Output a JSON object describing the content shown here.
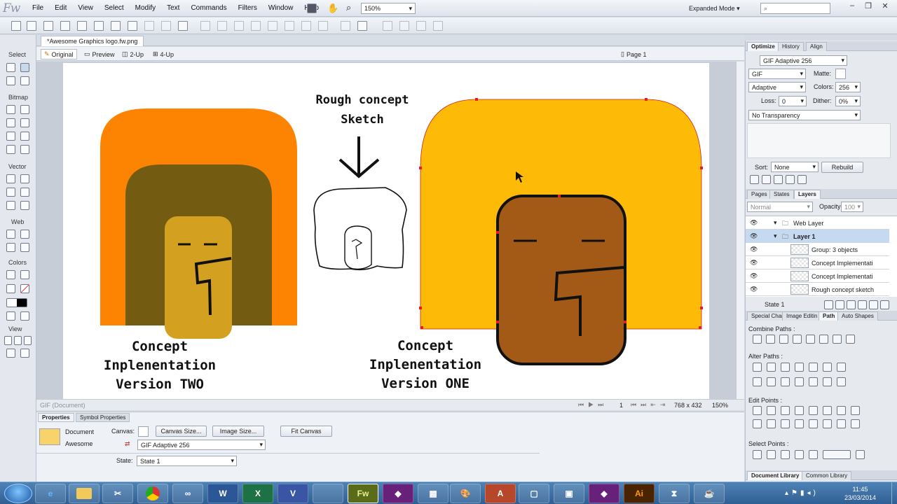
{
  "app": {
    "logo": "Fw",
    "menus": [
      "File",
      "Edit",
      "View",
      "Select",
      "Modify",
      "Text",
      "Commands",
      "Filters",
      "Window",
      "Help"
    ],
    "zoom": "150%",
    "mode": "Expanded Mode",
    "search_placeholder": ""
  },
  "tools": {
    "sections": [
      "Select",
      "Bitmap",
      "Vector",
      "Web",
      "Colors",
      "View"
    ]
  },
  "document": {
    "tab": "*Awesome Graphics logo.fw.png",
    "views": [
      "Original",
      "Preview",
      "2-Up",
      "4-Up"
    ],
    "page": "Page 1"
  },
  "canvas": {
    "rough_title": "Rough concept sketch",
    "caption_two": [
      "Concept",
      "Inplenentation",
      "Version TWO"
    ],
    "caption_one": [
      "Concept",
      "Inplenentation",
      "Version ONE"
    ],
    "colors": {
      "orange": "#fd8403",
      "olive": "#735c11",
      "mustard": "#d4a020",
      "gold": "#fdba07",
      "brown": "#a45a17"
    }
  },
  "status": {
    "left": "GIF (Document)",
    "frame": "1",
    "size": "768 x 432",
    "zoom": "150%"
  },
  "properties": {
    "tabs": [
      "Properties",
      "Symbol Properties"
    ],
    "doc_label": "Document",
    "doc_name": "Awesome",
    "canvas_label": "Canvas:",
    "canvas_size_btn": "Canvas Size...",
    "image_size_btn": "Image Size...",
    "fit_canvas_btn": "Fit Canvas",
    "format": "GIF Adaptive 256",
    "state_label": "State:",
    "state": "State 1"
  },
  "optimize": {
    "tabs": [
      "Optimize",
      "History",
      "Align"
    ],
    "preset": "GIF Adaptive 256",
    "format": "GIF",
    "matte_label": "Matte:",
    "palette": "Adaptive",
    "colors_label": "Colors:",
    "colors": "256",
    "loss_label": "Loss:",
    "loss": "0",
    "dither_label": "Dither:",
    "dither": "0%",
    "transparency": "No Transparency",
    "sort_label": "Sort:",
    "sort": "None",
    "rebuild": "Rebuild"
  },
  "layers": {
    "tabs": [
      "Pages",
      "States",
      "Layers"
    ],
    "blend": "Normal",
    "opacity_label": "Opacity",
    "opacity": "100",
    "rows": [
      "Web Layer",
      "Layer 1",
      "Group: 3 objects",
      "Concept Implementati",
      "Concept Implementati",
      "Rough concept sketch"
    ],
    "state": "State 1"
  },
  "path": {
    "tabs": [
      "Special Char",
      "Image Editin",
      "Path",
      "Auto Shapes"
    ],
    "combine": "Combine Paths :",
    "alter": "Alter Paths :",
    "edit": "Edit Points :",
    "select": "Select Points :"
  },
  "library": {
    "tabs": [
      "Document Library",
      "Common Library"
    ]
  },
  "taskbar": {
    "apps": [
      "e",
      "",
      "",
      "",
      "W",
      "X",
      "V",
      "Fw",
      "",
      "",
      "A",
      "",
      "",
      "",
      "",
      "Ai",
      "",
      ""
    ],
    "time": "11:45",
    "date": "23/03/2014"
  }
}
